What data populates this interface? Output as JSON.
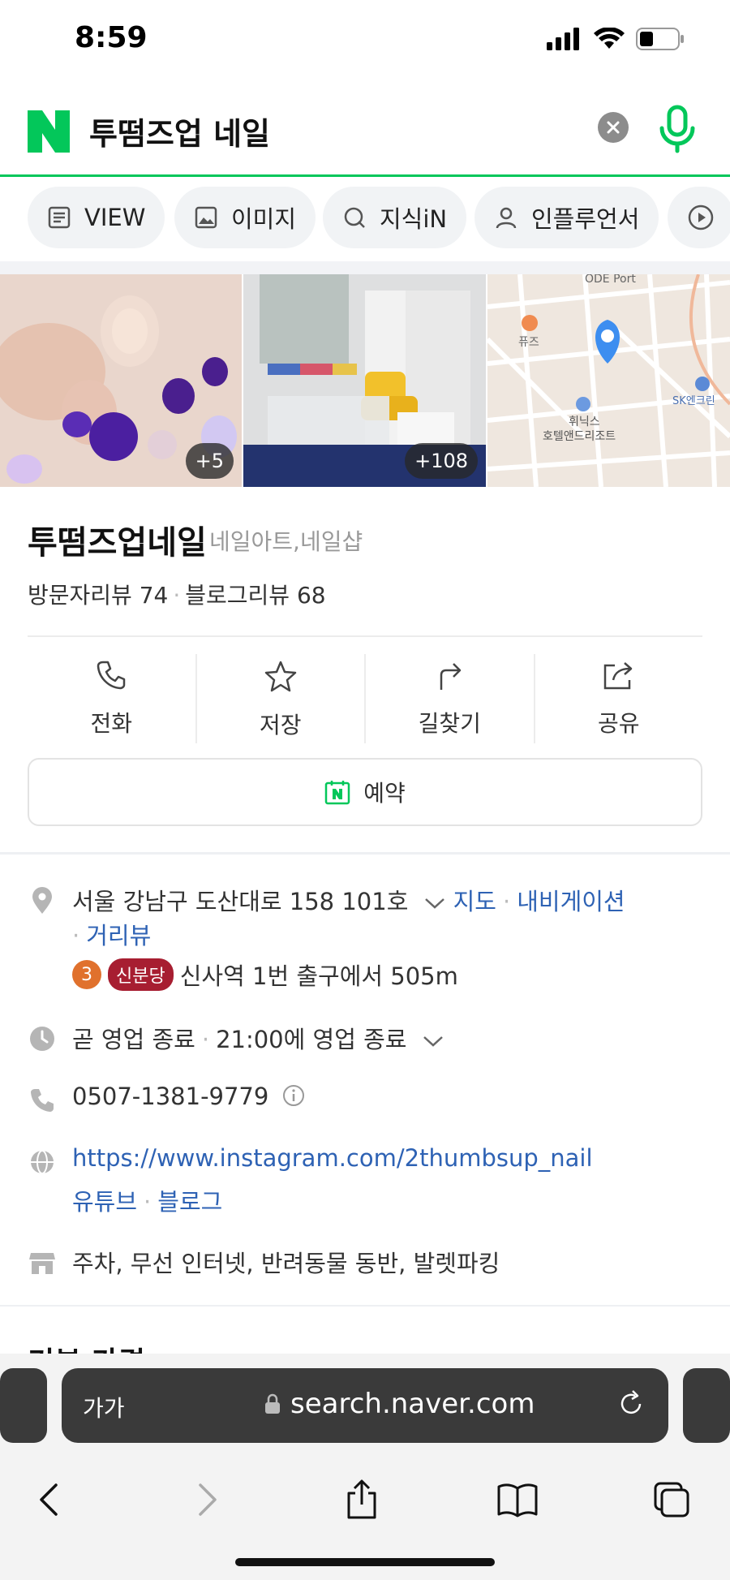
{
  "status": {
    "time": "8:59"
  },
  "search": {
    "query": "투떰즈업 네일"
  },
  "tabs": [
    {
      "label": "VIEW",
      "icon": "view-icon"
    },
    {
      "label": "이미지",
      "icon": "image-icon"
    },
    {
      "label": "지식iN",
      "icon": "kin-icon"
    },
    {
      "label": "인플루언서",
      "icon": "person-icon"
    }
  ],
  "photos": {
    "first_count": "+5",
    "second_count": "+108"
  },
  "map_labels": {
    "top": "ODE Port",
    "cafe": "퓨즈",
    "hotel_line1": "휘닉스",
    "hotel_line2": "호텔앤드리조트",
    "sk": "SK엔크린"
  },
  "place": {
    "name": "투떰즈업네일",
    "category": "네일아트,네일샵",
    "visitor_reviews": "방문자리뷰 74",
    "blog_reviews": "블로그리뷰 68"
  },
  "actions": {
    "call": "전화",
    "save": "저장",
    "directions": "길찾기",
    "share": "공유"
  },
  "reserve": {
    "label": "예약"
  },
  "info": {
    "address": "서울 강남구 도산대로 158 101호",
    "map_link": "지도",
    "navigation_link": "내비게이션",
    "streetview_link": "거리뷰",
    "subway_line": "3",
    "subway_line_name": "신분당",
    "subway_text": "신사역 1번 출구에서 505m",
    "hours_status": "곧 영업 종료",
    "hours_detail": "21:00에 영업 종료",
    "phone": "0507-1381-9779",
    "website": "https://www.instagram.com/2thumbsup_nail",
    "youtube": "유튜브",
    "blog": "블로그",
    "amenities": "주차, 무선 인터넷, 반려동물 동반, 발렛파킹"
  },
  "next_section": "기본 가격",
  "browser": {
    "text_size": "가가",
    "url": "search.naver.com"
  }
}
